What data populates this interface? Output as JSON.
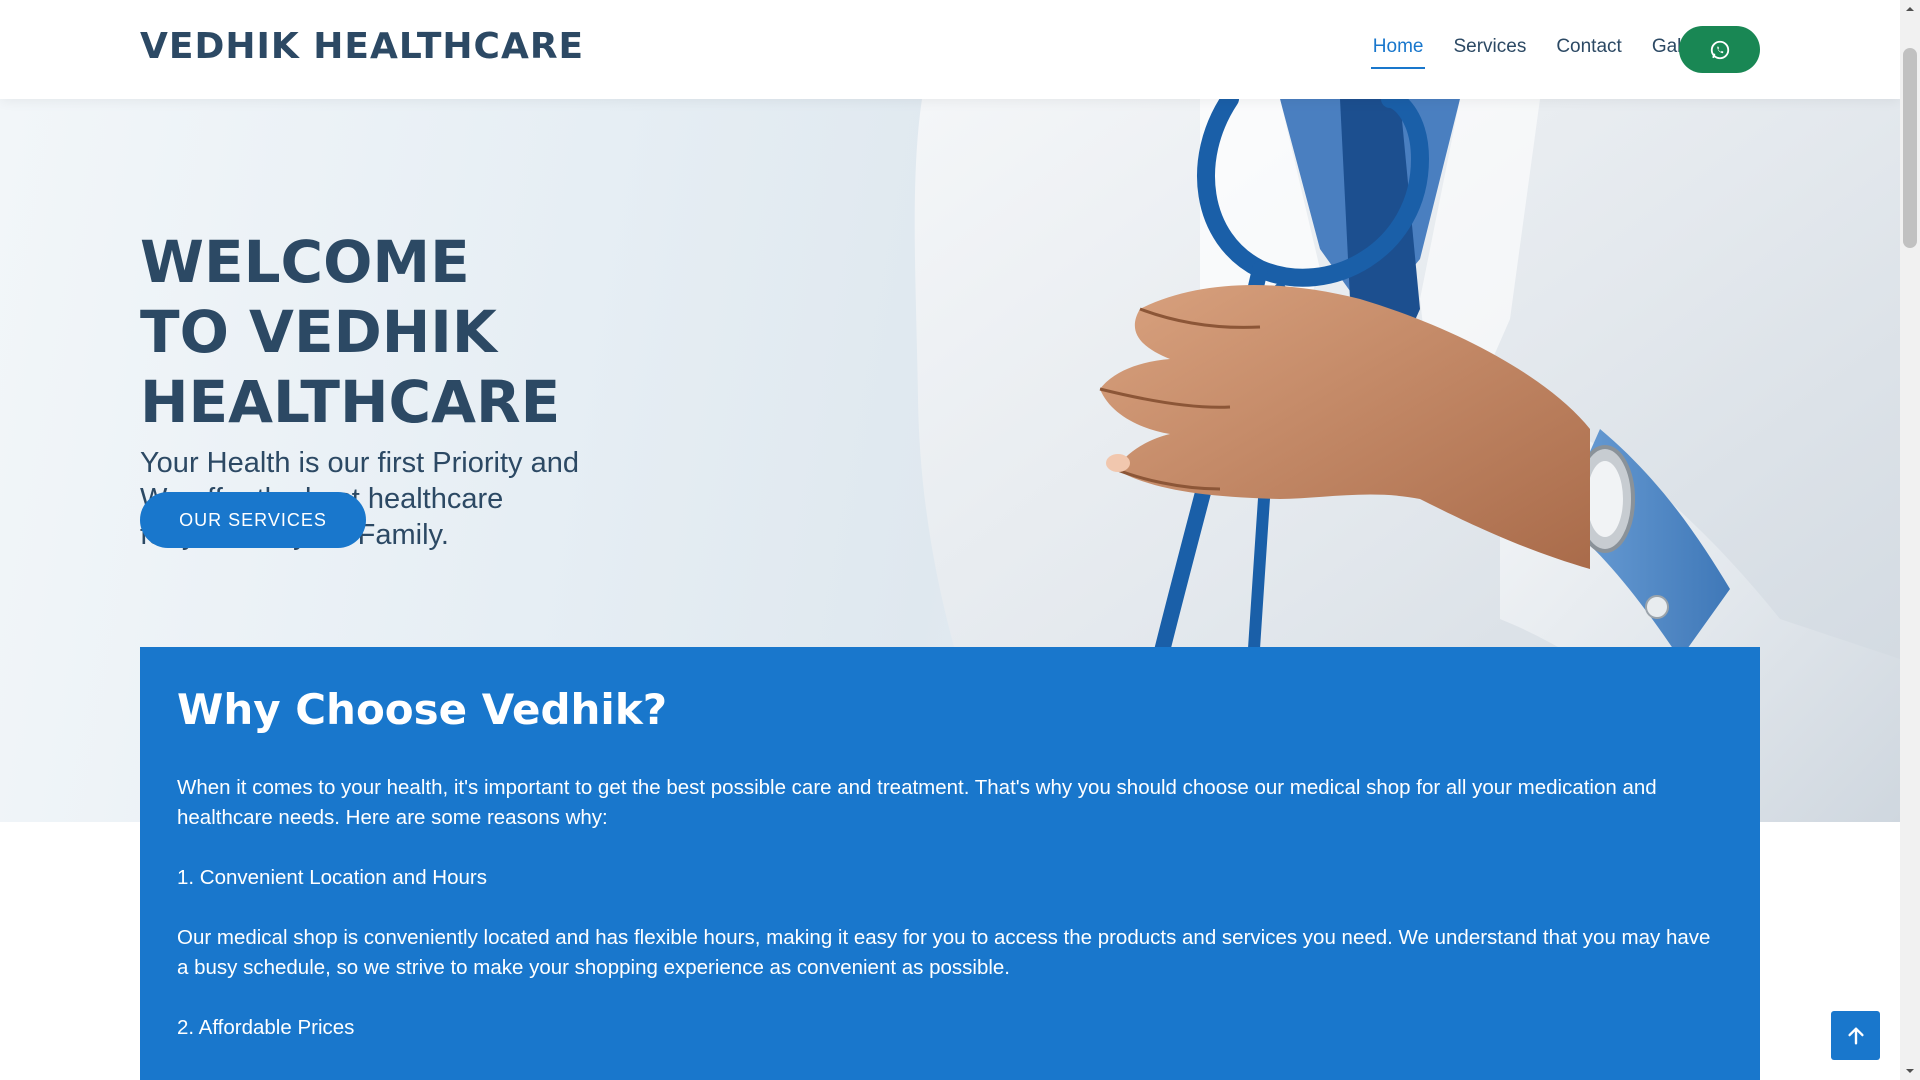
{
  "header": {
    "logo": "VEDHIK HEALTHCARE",
    "nav": [
      {
        "label": "Home",
        "active": true
      },
      {
        "label": "Services",
        "active": false
      },
      {
        "label": "Contact",
        "active": false
      },
      {
        "label": "Gallery",
        "active": false
      }
    ],
    "whatsapp_icon": "whatsapp-icon"
  },
  "hero": {
    "title_lines": [
      "WELCOME",
      "TO VEDHIK",
      "HEALTHCARE"
    ],
    "subtitle_lines": [
      "Your Health is our first Priority and",
      "We offer the best healthcare",
      "for you and your Family."
    ],
    "button_label": "OUR SERVICES"
  },
  "why": {
    "heading": "Why Choose Vedhik?",
    "paragraphs": [
      "When it comes to your health, it's important to get the best possible care and treatment. That's why you should choose our medical shop for all your medication and healthcare needs. Here are some reasons why:",
      "1. Convenient Location and Hours",
      "Our medical shop is conveniently located and has flexible hours, making it easy for you to access the products and services you need. We understand that you may have a busy schedule, so we strive to make your shopping experience as convenient as possible.",
      "2. Affordable Prices"
    ]
  },
  "colors": {
    "brand_blue": "#1977cc",
    "dark_text": "#2c4964",
    "whatsapp_green": "#198754"
  }
}
